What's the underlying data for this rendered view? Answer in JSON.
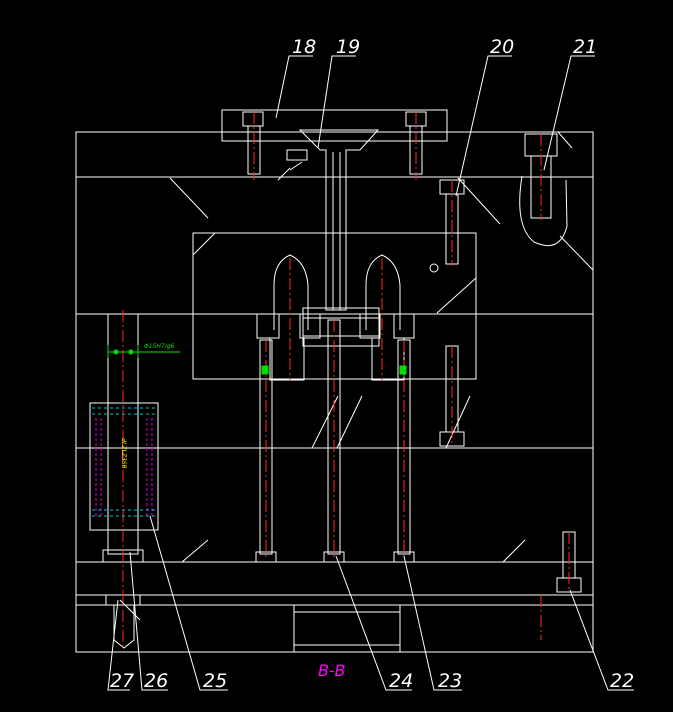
{
  "colors": {
    "background": "#000000",
    "outline": "#ffffff",
    "centerline": "#ff2a2a",
    "dimension": "#00e000",
    "guide_sleeve": "#d000d0",
    "section_label": "#ff00ff",
    "annotation": "#ffff00",
    "spring": "#00c8c8"
  },
  "section_label": "B-B",
  "dimension_text": "Φ15H7/g6",
  "vertical_note": "ԀLZLZ3SR",
  "callouts": [
    {
      "id": "callout-18",
      "text": "18"
    },
    {
      "id": "callout-19",
      "text": "19"
    },
    {
      "id": "callout-20",
      "text": "20"
    },
    {
      "id": "callout-21",
      "text": "21"
    },
    {
      "id": "callout-22",
      "text": "22"
    },
    {
      "id": "callout-23",
      "text": "23"
    },
    {
      "id": "callout-24",
      "text": "24"
    },
    {
      "id": "callout-25",
      "text": "25"
    },
    {
      "id": "callout-26",
      "text": "26"
    },
    {
      "id": "callout-27",
      "text": "27"
    }
  ]
}
